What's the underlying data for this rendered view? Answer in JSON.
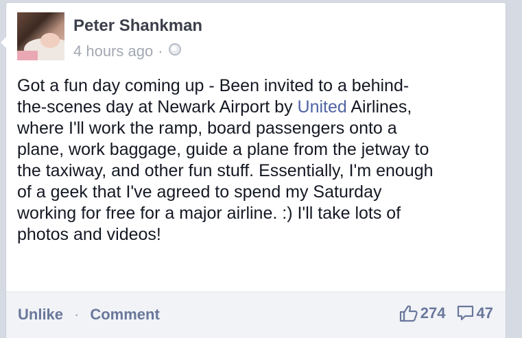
{
  "post": {
    "author": "Peter Shankman",
    "timestamp": "4 hours ago",
    "meta_separator": "·",
    "privacy_icon": "globe-icon",
    "text_lines": [
      {
        "before": "Got a fun day coming up - Been invited to a behind-",
        "link": "",
        "after": ""
      },
      {
        "before": "the-scenes day at Newark Airport by ",
        "link": "United",
        "after": " Airlines,"
      },
      {
        "before": "where I'll work the ramp, board passengers onto a",
        "link": "",
        "after": ""
      },
      {
        "before": "plane, work baggage, guide a plane from the jetway to",
        "link": "",
        "after": ""
      },
      {
        "before": "the taxiway, and other fun stuff. Essentially, I'm enough",
        "link": "",
        "after": ""
      },
      {
        "before": "of a geek that I've agreed to spend my Saturday",
        "link": "",
        "after": ""
      },
      {
        "before": "working for free for a major airline. :) I'll take lots of",
        "link": "",
        "after": ""
      },
      {
        "before": "photos and videos!",
        "link": "",
        "after": ""
      }
    ]
  },
  "footer": {
    "unlike_label": "Unlike",
    "separator": "·",
    "comment_label": "Comment",
    "like_icon": "thumbs-up-icon",
    "like_count": "274",
    "comment_icon": "comment-bubble-icon",
    "comment_count": "47"
  },
  "colors": {
    "link": "#4e63a3",
    "action_text": "#69779a",
    "footer_bg": "#f1f3f7",
    "page_bg": "#d6dae3"
  }
}
